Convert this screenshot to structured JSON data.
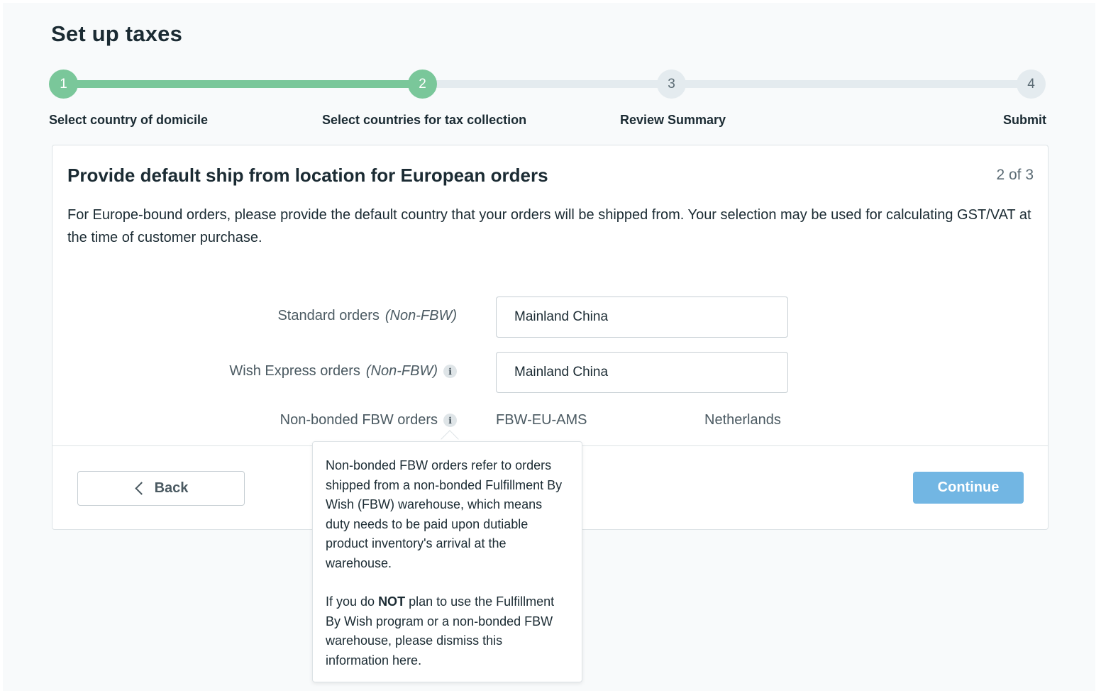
{
  "page": {
    "title": "Set up taxes"
  },
  "stepper": {
    "steps": [
      {
        "number": "1",
        "label": "Select country of domicile",
        "state": "complete"
      },
      {
        "number": "2",
        "label": "Select countries for tax collection",
        "state": "current"
      },
      {
        "number": "3",
        "label": "Review Summary",
        "state": "upcoming"
      },
      {
        "number": "4",
        "label": "Submit",
        "state": "upcoming"
      }
    ],
    "colors": {
      "complete": "#7ac79a",
      "upcoming": "#e4ebef"
    }
  },
  "card": {
    "title": "Provide default ship from location for European orders",
    "count": "2 of 3",
    "description": "For Europe-bound orders, please provide the default country that your orders will be shipped from. Your selection may be used for calculating GST/VAT at the time of customer purchase."
  },
  "form": {
    "standard": {
      "label": "Standard orders",
      "qualifier": "(Non-FBW)",
      "value": "Mainland China"
    },
    "express": {
      "label": "Wish Express orders",
      "qualifier": "(Non-FBW)",
      "value": "Mainland China",
      "icon": "info-icon"
    },
    "fbw": {
      "label": "Non-bonded FBW orders",
      "warehouse": "FBW-EU-AMS",
      "country": "Netherlands",
      "icon": "info-icon"
    }
  },
  "actions": {
    "back_label": "Back",
    "continue_label": "Continue",
    "continue_color": "#72b6e3"
  },
  "tooltip": {
    "paragraph1": "Non-bonded FBW orders refer to orders shipped from a non-bonded Fulfillment By Wish (FBW) warehouse, which means duty needs to be paid upon dutiable product inventory's arrival at the warehouse.",
    "paragraph2_before": "If you do ",
    "paragraph2_bold": "NOT",
    "paragraph2_after": " plan to use the Fulfillment By Wish program or a non-bonded FBW warehouse, please dismiss this information here."
  }
}
